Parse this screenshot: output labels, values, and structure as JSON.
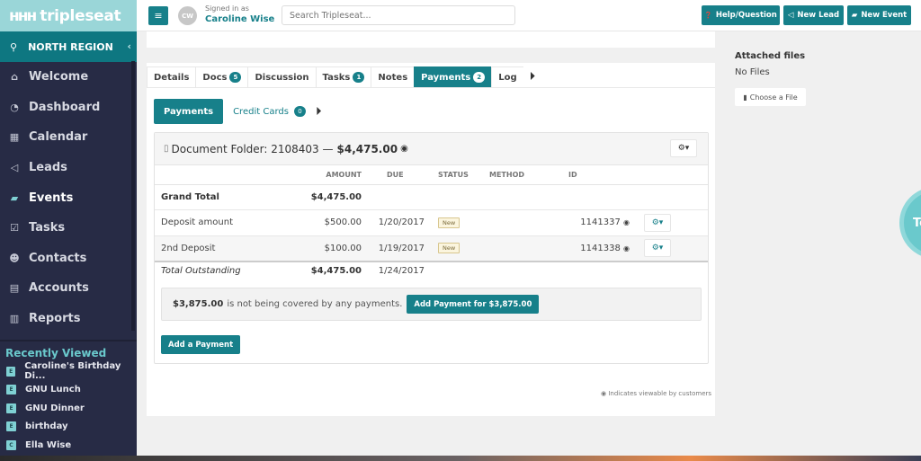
{
  "brand": {
    "logo_mark": "ннн",
    "name": "tripleseat"
  },
  "region": {
    "label": "NORTH REGION"
  },
  "nav": [
    {
      "label": "Welcome",
      "icon": "home-icon",
      "glyph": "⌂"
    },
    {
      "label": "Dashboard",
      "icon": "dashboard-icon",
      "glyph": "◔"
    },
    {
      "label": "Calendar",
      "icon": "calendar-icon",
      "glyph": "▦"
    },
    {
      "label": "Leads",
      "icon": "bullhorn-icon",
      "glyph": "◁"
    },
    {
      "label": "Events",
      "icon": "book-icon",
      "glyph": "▰",
      "active": true
    },
    {
      "label": "Tasks",
      "icon": "checkbox-icon",
      "glyph": "☑"
    },
    {
      "label": "Contacts",
      "icon": "users-icon",
      "glyph": "☻"
    },
    {
      "label": "Accounts",
      "icon": "building-icon",
      "glyph": "▤"
    },
    {
      "label": "Reports",
      "icon": "bar-chart-icon",
      "glyph": "▥"
    }
  ],
  "recent": {
    "title": "Recently Viewed",
    "items": [
      {
        "badge": "E",
        "label": "Caroline's Birthday Di..."
      },
      {
        "badge": "E",
        "label": "GNU Lunch"
      },
      {
        "badge": "E",
        "label": "GNU Dinner"
      },
      {
        "badge": "E",
        "label": "birthday"
      },
      {
        "badge": "C",
        "label": "Ella Wise"
      }
    ]
  },
  "topbar": {
    "menu_glyph": "≡",
    "avatar_initials": "CW",
    "signed_in_label": "Signed in as",
    "user_name": "Caroline Wise",
    "search_placeholder": "Search Tripleseat...",
    "buttons": [
      {
        "label": "Help/Question",
        "glyph": "❓"
      },
      {
        "label": "New Lead",
        "glyph": "◁"
      },
      {
        "label": "New Event",
        "glyph": "▰"
      }
    ]
  },
  "tabs": [
    {
      "label": "Details",
      "badge": null
    },
    {
      "label": "Docs",
      "badge": "5"
    },
    {
      "label": "Discussion",
      "badge": null
    },
    {
      "label": "Tasks",
      "badge": "1"
    },
    {
      "label": "Notes",
      "badge": null
    },
    {
      "label": "Payments",
      "badge": "2",
      "active": true
    },
    {
      "label": "Log",
      "badge": null
    }
  ],
  "subtabs": {
    "payments": "Payments",
    "credit_cards": "Credit Cards",
    "credit_cards_badge": "0"
  },
  "folder": {
    "title": "Document Folder: 2108403 —",
    "amount": "$4,475.00"
  },
  "table": {
    "headers": [
      "",
      "AMOUNT",
      "DUE",
      "STATUS",
      "METHOD",
      "ID"
    ],
    "grand_total": {
      "label": "Grand Total",
      "amount": "$4,475.00"
    },
    "rows": [
      {
        "label": "Deposit amount",
        "amount": "$500.00",
        "due": "1/20/2017",
        "status": "New",
        "method": "",
        "id": "1141337"
      },
      {
        "label": "2nd Deposit",
        "amount": "$100.00",
        "due": "1/19/2017",
        "status": "New",
        "method": "",
        "id": "1141338"
      }
    ],
    "total_outstanding": {
      "label": "Total Outstanding",
      "amount": "$4,475.00",
      "due": "1/24/2017"
    }
  },
  "notice": {
    "amount": "$3,875.00",
    "text": "is not being covered by any payments.",
    "button": "Add Payment for $3,875.00"
  },
  "add_payment_button": "Add a Payment",
  "footnote": "Indicates viewable by customers",
  "attachments": {
    "title": "Attached files",
    "empty": "No Files",
    "choose_button": "Choose a File"
  },
  "help_bubble": {
    "label": "To"
  },
  "colors": {
    "brand_teal": "#17808a",
    "sidebar_bg": "#272b45",
    "logo_bg": "#9ad6d8",
    "accent_light": "#6ac9cc"
  }
}
